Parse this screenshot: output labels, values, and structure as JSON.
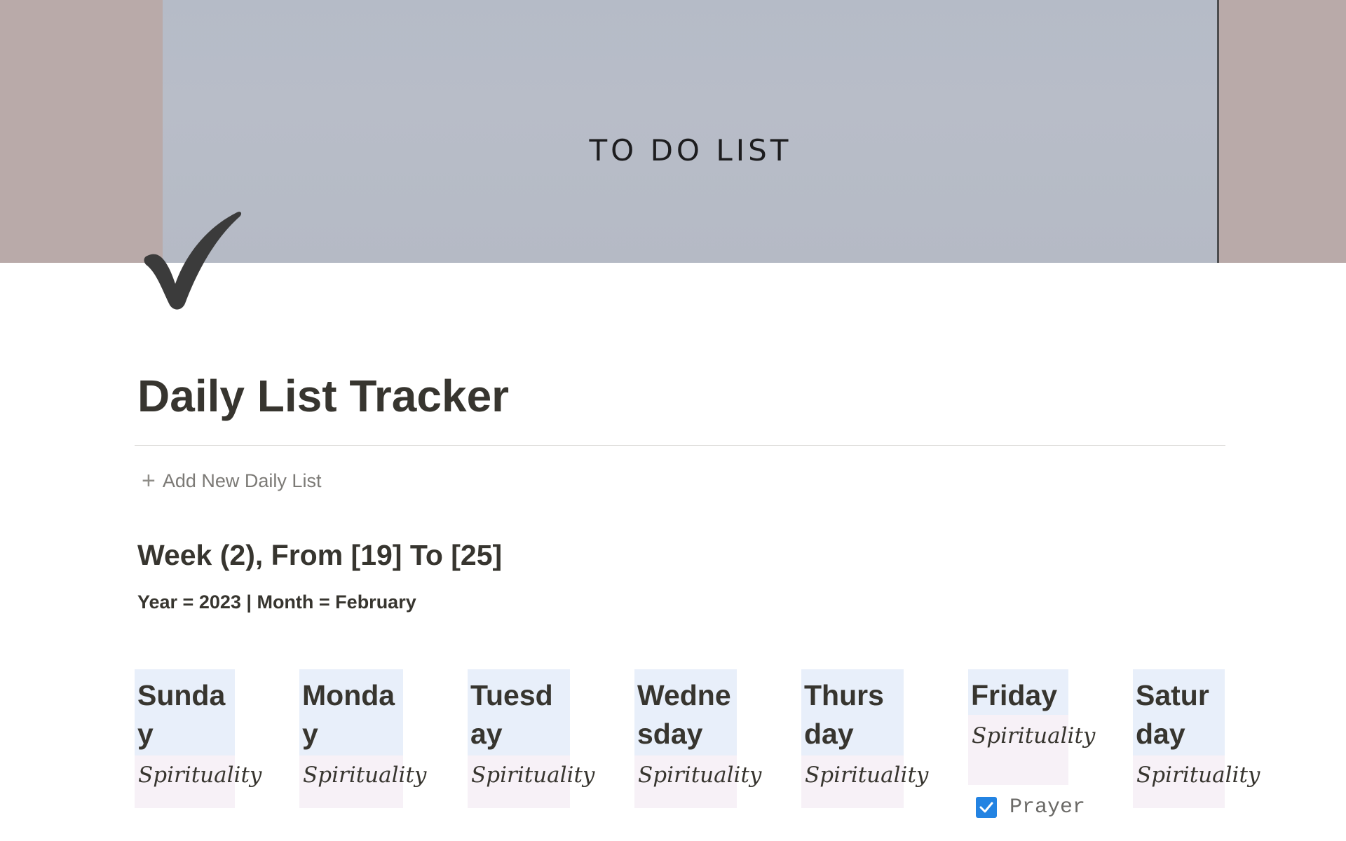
{
  "cover": {
    "text": "TO DO LIST"
  },
  "page": {
    "title": "Daily List Tracker",
    "add_new_label": "Add New Daily List",
    "week_heading": "Week (2), From [19] To [25]",
    "month_line": "Year = 2023 | Month = February"
  },
  "days": [
    {
      "name": "Sunday",
      "tag": "Spirituality"
    },
    {
      "name": "Monday",
      "tag": "Spirituality"
    },
    {
      "name": "Tuesday",
      "tag": "Spirituality"
    },
    {
      "name": "Wednesday",
      "tag": "Spirituality"
    },
    {
      "name": "Thursday",
      "tag": "Spirituality"
    },
    {
      "name": "Friday",
      "tag": "Spirituality"
    },
    {
      "name": "Saturday",
      "tag": "Spirituality"
    }
  ],
  "friday_todo": {
    "label": "Prayer",
    "checked": true
  },
  "colors": {
    "accent": "#2383e2",
    "day_header_bg": "#e8effa",
    "tag_bg": "#f7f1f7"
  }
}
